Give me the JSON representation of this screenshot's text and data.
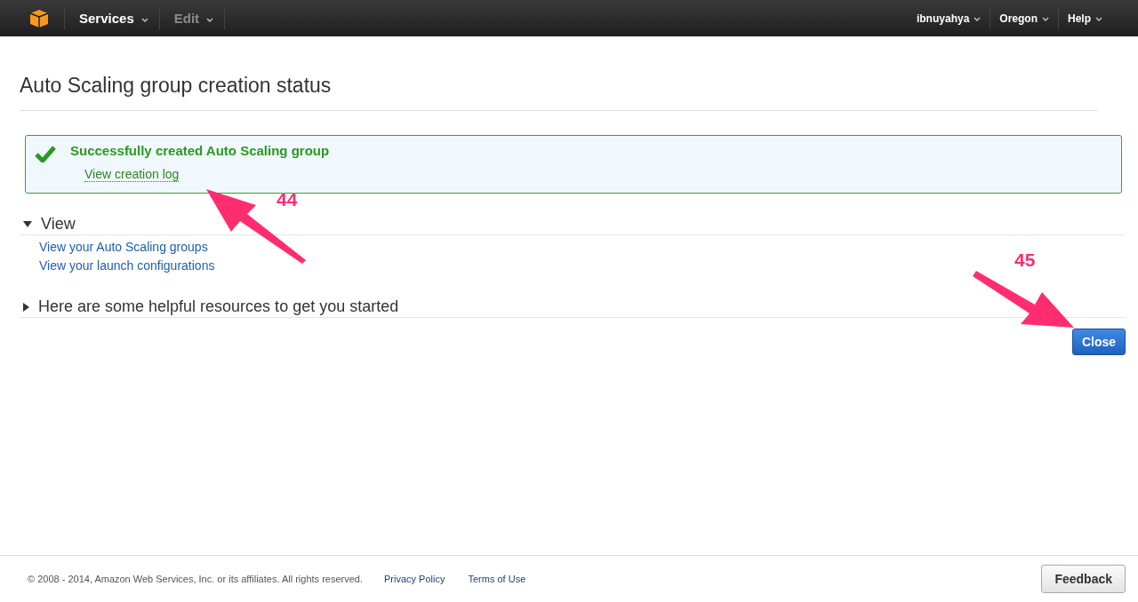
{
  "nav": {
    "left": [
      {
        "label": "Services",
        "disabled": false
      },
      {
        "label": "Edit",
        "disabled": true
      }
    ],
    "right": [
      "ibnuyahya",
      "Oregon",
      "Help"
    ]
  },
  "page_title": "Auto Scaling group creation status",
  "success": {
    "message": "Successfully created Auto Scaling group",
    "link": "View creation log"
  },
  "sections": [
    {
      "title": "View",
      "expanded": true,
      "links": [
        "View your Auto Scaling groups",
        "View your launch configurations"
      ]
    },
    {
      "title": "Here are some helpful resources to get you started",
      "expanded": false
    }
  ],
  "close_button": "Close",
  "annotations": [
    {
      "label": "44"
    },
    {
      "label": "45"
    }
  ],
  "footer": {
    "copyright": "© 2008 - 2014, Amazon Web Services, Inc. or its affiliates. All rights reserved.",
    "links": [
      "Privacy Policy",
      "Terms of Use"
    ],
    "feedback": "Feedback"
  }
}
